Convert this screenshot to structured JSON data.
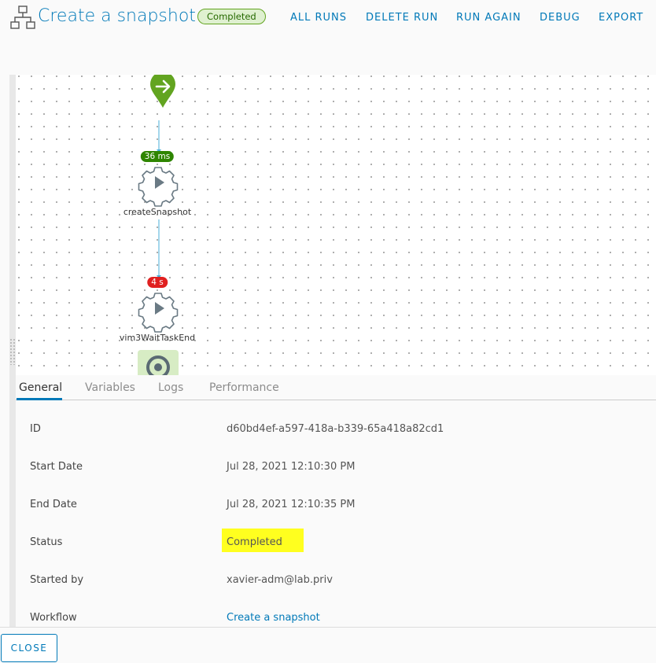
{
  "header": {
    "title": "Create a snapshot",
    "status_badge": "Completed",
    "actions": [
      "ALL RUNS",
      "DELETE RUN",
      "RUN AGAIN",
      "DEBUG",
      "EXPORT"
    ]
  },
  "canvas": {
    "nodes": [
      {
        "name": "createSnapshot",
        "duration": "36 ms",
        "duration_color": "#2e8500"
      },
      {
        "name": "vim3WaitTaskEnd",
        "duration": "4 s",
        "duration_color": "#e02020"
      }
    ],
    "start_icon": "arrow-right-icon",
    "end_icon": "target-icon",
    "task_icon": "gear-play-icon"
  },
  "tabs": [
    "General",
    "Variables",
    "Logs",
    "Performance"
  ],
  "active_tab": "General",
  "details": {
    "id_label": "ID",
    "id_value": "d60bd4ef-a597-418a-b339-65a418a82cd1",
    "start_label": "Start Date",
    "start_value": "Jul 28, 2021 12:10:30 PM",
    "end_label": "End Date",
    "end_value": "Jul 28, 2021 12:10:35 PM",
    "status_label": "Status",
    "status_value": "Completed",
    "started_by_label": "Started by",
    "started_by_value": "xavier-adm@lab.priv",
    "workflow_label": "Workflow",
    "workflow_value": "Create a snapshot"
  },
  "footer": {
    "close_label": "CLOSE"
  },
  "colors": {
    "accent": "#0079b8",
    "success": "#62a420",
    "error": "#e02020",
    "highlight": "#ffff1f"
  }
}
